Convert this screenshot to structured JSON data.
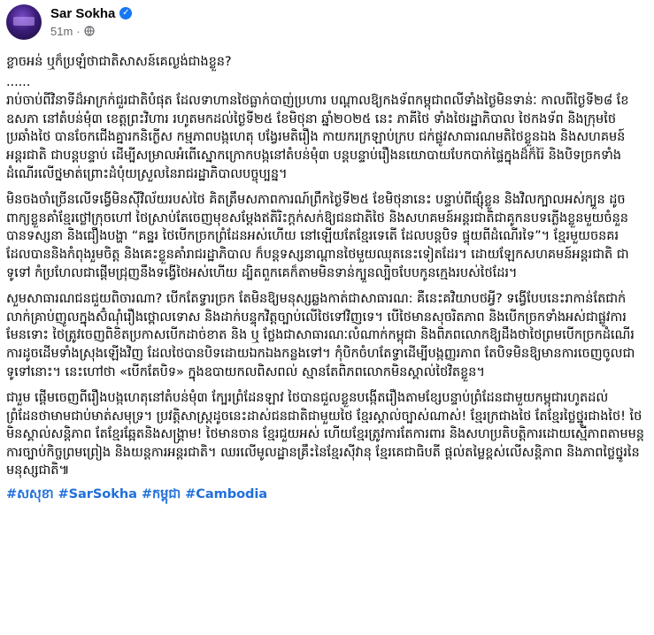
{
  "author": {
    "name": "Sar Sokha",
    "verified": true,
    "time": "51m",
    "separator": "·",
    "privacy_icon": "globe-icon"
  },
  "post": {
    "headline": "ខ្លាចអន់ ឬក៏ប្រឡំថាជាតិសាសន៍គេល្ងង់ជាងខ្លួន?",
    "dots": "......",
    "paragraphs": [
      "រាប់ចាប់ពីវិនាទីដ៏អាក្រក់ជួរជាតិបំផុត ដែលទាហានថៃធ្លាក់បាញ់ប្រហារ បណ្ដាលឱ្យកងទ័ពកម្ពុជាពលីទាំងថ្ងៃមិនទាន់ៈ កាលពីថ្ងៃទី២៨ ខែឧសភា នៅតំបន់មុំ៣ ខេត្តព្រះវិហារ រហូតមកដល់ថ្ងៃទី២៥ ខែមិថុនា ឆ្នាំ២០២៥ នេះ ភាគីថៃ ទាំងថៃរដ្ឋាភិបាល ថៃកងទ័ព និងក្រុមថៃប្រឆាំងថៃ បានចែកជើងគ្នារកនិកើ្ងស កម្មភាពបង្កហេតុ បង្វែរមតិរឿង កាយករក្រឡាប់ក្រប ជក់ផ្លូវសាធារណមតិថៃខ្លួនឯង និងសហគមន៍អន្តរជាតិ ជាបន្តបន្ទាប់ ដើម្បីសម្រាលអំពើស្នោកក្រោកបង្កនៅតំបន់មុំ៣ បន្តបន្ទាប់រឿងនយោបាយបែកបាក់ផ្ទៃក្នុងដ៏ក៏រ៉ៃ និងបិទច្រកទាំងដំណើរលើថ្នមាត់ព្រោះដំបុំយស្រួលនៃរាជរដ្ឋាភិបាលបច្ចុប្បន្ន។",
      "មិនចងចាំច្រើនលើទង្វើមិនស៊ីវិល័យរបស់ថៃ គិតត្រឹមសភាពការណ៍ព្រឹកថ្ងៃទី២៥ ខែមិថុនានេះ បន្ទាប់ពីផ្សុំខ្លួន និងវិលក្បាលអស់ក្បួន ដូចពាក្យខ្លួនគាំខ្មែរថ្លៅក្រុចហៅ ថៃស្រាប់តែចេញមុខសម្ដែងឥតិរិះក្ដក់សក់ឱ្យជនជាតិថៃ និងសហគមន៍អន្តរជាតិជាគូកនបទភ្លើងខ្លួនមួយចំនួនបានទស្សនា និងជឿងបង្ហា “គន្ឋរ ថៃបើកច្រកព្រំដែនអស់ហើយ នៅឡើយតែខ្មែរទេតើ ដែលបន្តបិទ ផ្ទុយពីដំណើរទៃ”។ ខ្មែរមួយចនគរ ដែលបាននិងកំពុងរួមចិត្ត និងគេះខ្លួនគាំរាជរដ្ឋាភិបាល ក៏បន្តទស្សនាណ្ដានថៃមួយឈុតនេះទៀតដែរ។ ដោយឡែកសហគមន៍អន្តរជាតិ ជាទូទៅ កំប្រហែលជាផ្ដើមជ្រុញនឹងទង្វើថៃអស់ហើយ ដ្បិតពួកគេក៏តាមមិនទាន់ក្បួនល្បិចបែបកូនក្មេងរបស់ថៃដែរ។",
      "សួមសាធារណជនជួយពិចារណា? បើកតែទ្វារច្រក តែមិនឱ្យមនុស្សឆ្លងកាត់ជាសាធារណ: គឺនេះគវិយាបថអ្វី? ទង្វើបែបនេះរាកាន់តែជាក់លាក់គ្រាប់ញូលក្នុងស៊ំណុំរឿងថ្ពោលទោស និងដាក់បន្ទុកវិត្តច្បាប់លើថៃទៅវិញទេ។ បើថៃមានសុចរិតភាព និងបើកច្រកទាំងអស់ជាផ្លូវការមែនទោះ ថៃត្រូវចេញពិខិតប្រកាសបើកដាច់ខាត និង ឬ ថ្លែងជាសាធារណៈលំណាក់កម្ពុជា និងពិភពលោកឱ្យដឹងថាថៃព្រមបើកច្រកដំណើរការដូចដើមទាំងស្រុងឡើងវិញ ដែលថៃបានបិទដោយឯកឯងកន្លងទៅ។ កុំបិកចំហតែទ្វាដើម្បីបង្កញ្ញរភាព តែបិទមិនឱ្យមានការចេញចូលជាទូទៅនោះ។ នេះហៅថា «បើកតែបិទ» ក្នុងឧបាយកលពិសពល់ ស្មានតែពិភពលោកមិនស្គាល់ថៃវិតខ្លួន។",
      "ជារួម ផ្ដើមចេញពីរឿងបង្កហេតុនៅតំបន់មុំ៣ ក្បែរព្រំដែនឡាវ ថៃបានជួលខ្លួនបង្កើតរឿងតាមខ្សែបន្ទាប់ព្រំដែនជាមួយកម្ពុជារហូតដល់ព្រំដែនថាមាមជាប់មាត់សមុទ្រ។ ប្រវត្តិសាស្ត្រដូចនេះដាស់ជនជាតិជាមួយថៃ ខ្មែរស្គាល់ច្បាស់ណាស់! ខ្មែរក្រជាងថៃ តែខ្មែរថ្លៃថ្នូរជាងថៃ! ថៃមិនស្គាល់សន្ដិភាព តែខ្មែរឆ្អែតនិងសង្គ្រាម! ថៃមានចាន ខ្មែរជួយអស់ ហើយខ្មែរត្រូវការតែការពារ និងសហប្រតិបត្តិការដោយស្មើភាពតាមមន្តការច្បាប់កិច្ចព្រមព្រៀង និងយន្តការអន្តរជាតិ។ ឈរលើមូលដ្ឋានគ្រឹះនៃខ្មែរស៊ីវានុ ខ្មែរគេជាធិបតី ផ្ដល់តម្លៃខ្ពស់លើសន្តិភាព និងភាពថ្លៃថ្នូរនៃមនុស្សជាតិ៕"
    ],
    "hashtags": [
      "#សសុខា",
      "#SarSokha",
      "#កម្ពុជា",
      "#Cambodia"
    ]
  },
  "colors": {
    "text": "#050505",
    "meta": "#65676b",
    "link": "#216fdb",
    "verified_badge": "#1877f2"
  }
}
